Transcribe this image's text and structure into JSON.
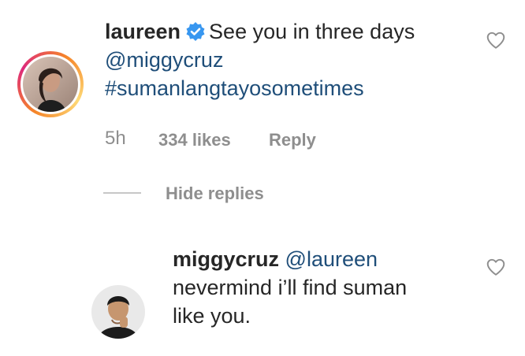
{
  "comment": {
    "username": "laureen",
    "text": "See you in three days",
    "mention": "@miggycruz",
    "hashtag": "#sumanlangtayosometimes",
    "time": "5h",
    "likes": "334 likes",
    "reply_label": "Reply"
  },
  "replies_toggle": {
    "label": "Hide replies"
  },
  "reply": {
    "username": "miggycruz",
    "mention": "@laureen",
    "text_line1": "nevermind i’ll find suman",
    "text_line2": "like you."
  }
}
